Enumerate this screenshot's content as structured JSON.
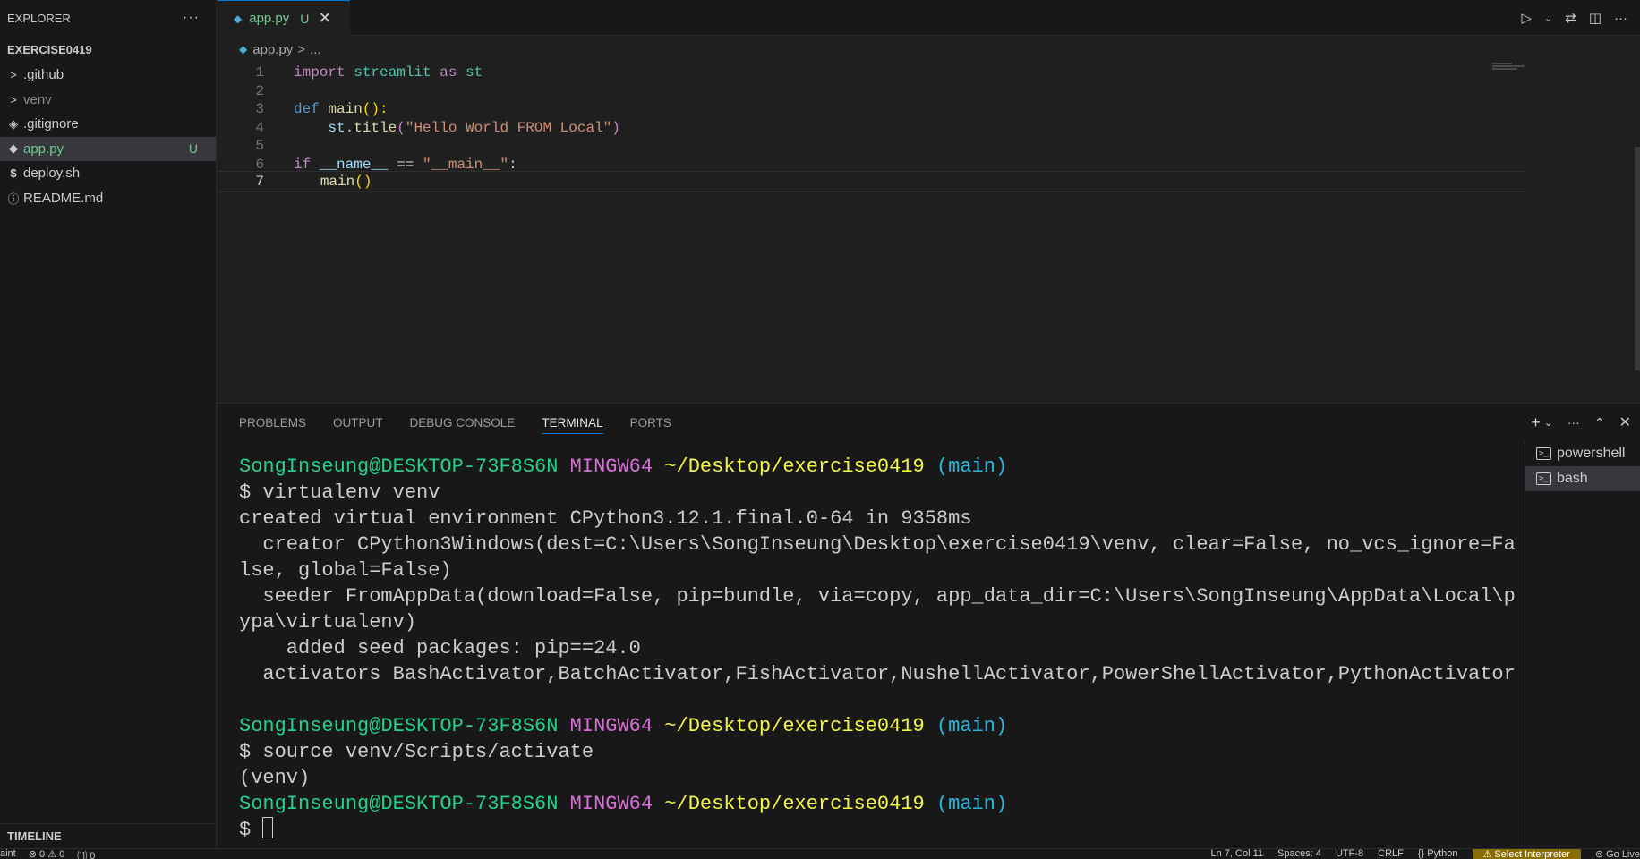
{
  "sidebar": {
    "title": "EXPLORER",
    "more": "···",
    "root": "EXERCISE0419",
    "items": [
      {
        "label": ".github",
        "twisty": ">",
        "icon": "",
        "badge": ""
      },
      {
        "label": "venv",
        "twisty": ">",
        "icon": "",
        "badge": ""
      },
      {
        "label": ".gitignore",
        "twisty": "",
        "icon": "◈",
        "badge": ""
      },
      {
        "label": "app.py",
        "twisty": "",
        "icon": "◆",
        "badge": "U"
      },
      {
        "label": "deploy.sh",
        "twisty": "",
        "icon": "$",
        "badge": ""
      },
      {
        "label": "README.md",
        "twisty": "",
        "icon": "ⓘ",
        "badge": ""
      }
    ],
    "timeline": "TIMELINE"
  },
  "tab": {
    "name": "app.py",
    "status": "U",
    "close": "✕"
  },
  "breadcrumb": {
    "file": "app.py",
    "sep": ">",
    "rest": "..."
  },
  "editor": {
    "line_numbers": [
      "1",
      "2",
      "3",
      "4",
      "5",
      "6",
      "7"
    ],
    "code": {
      "l1": {
        "kw": "import",
        "mod": "streamlit",
        "as": "as",
        "alias": "st"
      },
      "l3": {
        "kw": "def",
        "fn": "main",
        "paren": "():"
      },
      "l4": {
        "obj": "st",
        "dot": ".",
        "fn": "title",
        "open": "(",
        "str": "\"Hello World FROM Local\"",
        "close": ")"
      },
      "l6": {
        "kw": "if",
        "var": "__name__",
        "op": "==",
        "str": "\"__main__\"",
        "colon": ":"
      },
      "l7": {
        "fn": "main",
        "paren": "()"
      }
    }
  },
  "panel": {
    "tabs": [
      "PROBLEMS",
      "OUTPUT",
      "DEBUG CONSOLE",
      "TERMINAL",
      "PORTS"
    ],
    "terminals": [
      "powershell",
      "bash"
    ],
    "prompt": {
      "user": "SongInseung@DESKTOP-73F8S6N",
      "env": "MINGW64",
      "path": "~/Desktop/exercise0419",
      "branch": "(main)"
    },
    "lines": {
      "cmd1": "$ virtualenv venv",
      "out1": "created virtual environment CPython3.12.1.final.0-64 in 9358ms",
      "out2": "  creator CPython3Windows(dest=C:\\Users\\SongInseung\\Desktop\\exercise0419\\venv, clear=False, no_vcs_ignore=Fa",
      "out3": "lse, global=False)",
      "out4": "  seeder FromAppData(download=False, pip=bundle, via=copy, app_data_dir=C:\\Users\\SongInseung\\AppData\\Local\\p",
      "out5": "ypa\\virtualenv)",
      "out6": "    added seed packages: pip==24.0",
      "out7": "  activators BashActivator,BatchActivator,FishActivator,NushellActivator,PowerShellActivator,PythonActivator",
      "cmd2": "$ source venv/Scripts/activate",
      "out8": "(venv)",
      "cmd3": "$ "
    }
  },
  "statusbar": {
    "left": [
      "aint",
      "⊗ 0 ⚠ 0",
      "⑾ 0"
    ],
    "position": "Ln 7, Col 11",
    "spaces": "Spaces: 4",
    "encoding": "UTF-8",
    "eol": "CRLF",
    "language": "{} Python",
    "interpreter": "⚠ Select Interpreter",
    "golive": "⊚ Go Live"
  }
}
